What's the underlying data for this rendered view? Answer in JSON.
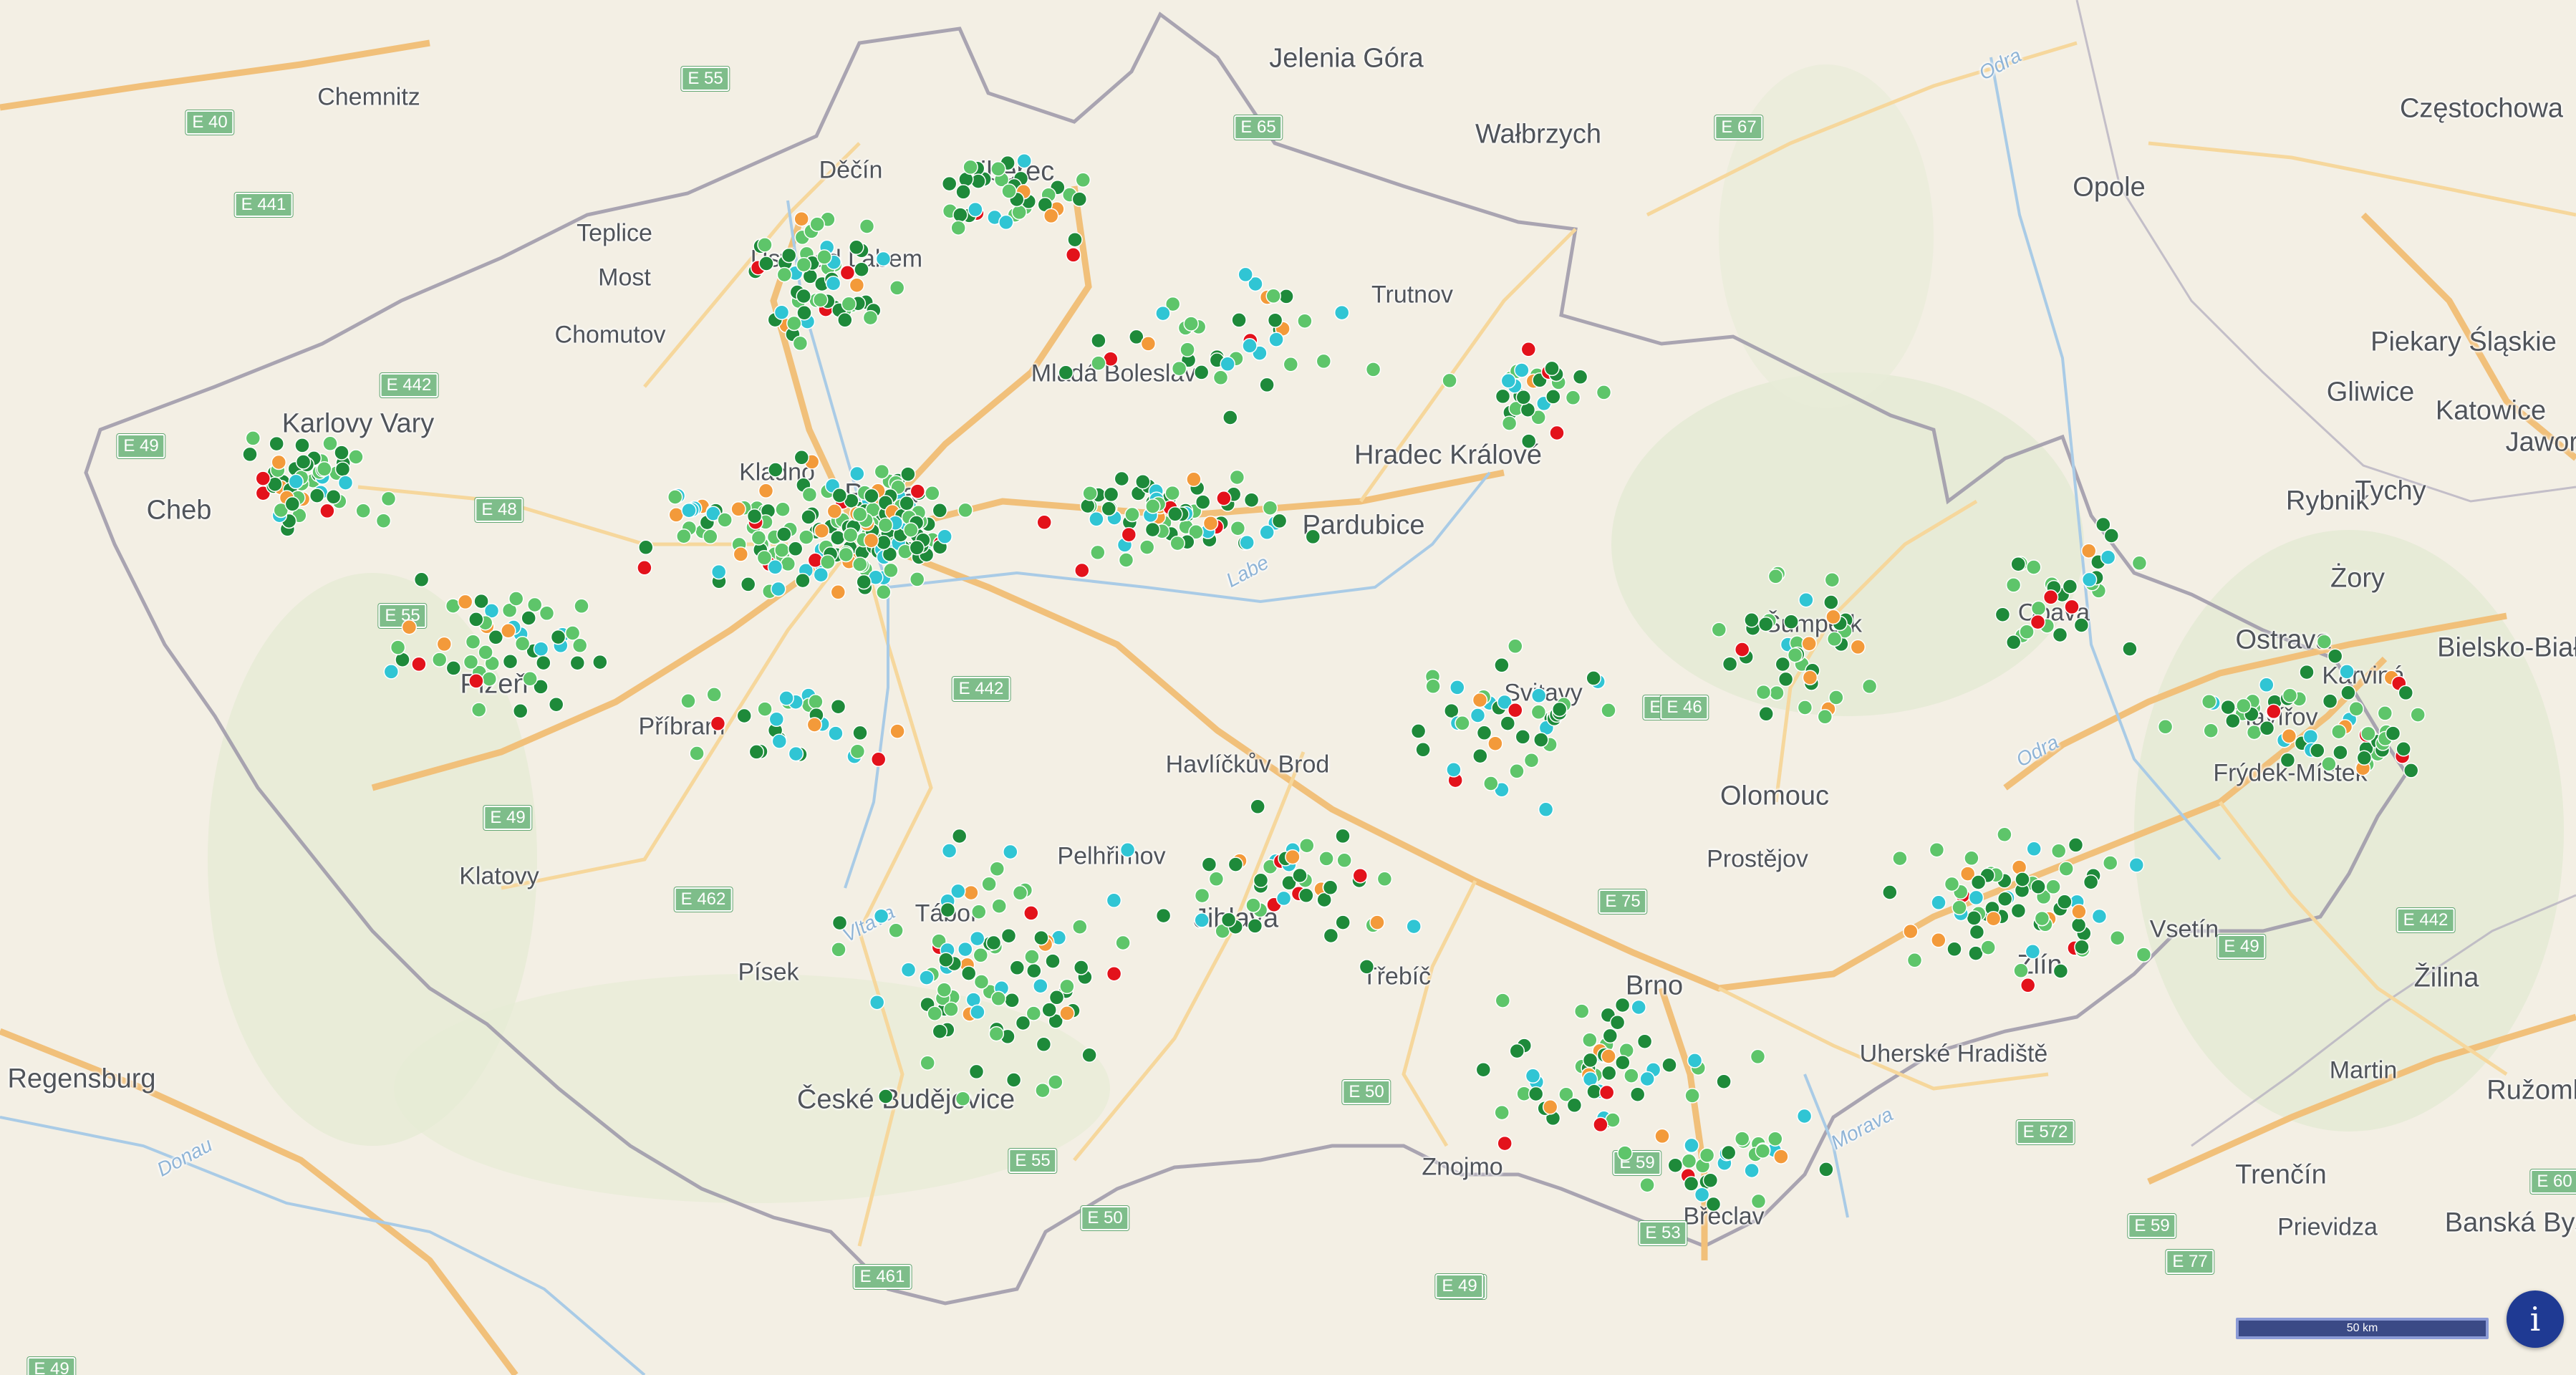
{
  "map": {
    "cities": [
      "Chemnitz",
      "Jelenia Góra",
      "Wałbrzych",
      "Częstochowa",
      "Opole",
      "Liberec",
      "Teplice",
      "Ústí nad Labem",
      "Most",
      "Chomutov",
      "Děčín",
      "Trutnov",
      "Mladá Boleslav",
      "Hradec Králové",
      "Pardubice",
      "Karlovy Vary",
      "Kladno",
      "Praha",
      "Piekary Śląskie",
      "Gliwice",
      "Katowice",
      "Jaworzno",
      "Rybnik",
      "Tychy",
      "Żory",
      "Šumperk",
      "Opava",
      "Ostrava",
      "Bielsko-Biała",
      "Karviná",
      "Havířov",
      "Frýdek-Místek",
      "Plzeň",
      "Příbram",
      "Havlíčkův Brod",
      "Svitavy",
      "Olomouc",
      "Klatovy",
      "Pelhřimov",
      "Prostějov",
      "Tábor",
      "Jihlava",
      "Vsetín",
      "Zlín",
      "Písek",
      "Žilina",
      "Brno",
      "Třebíč",
      "Regensburg",
      "Martin",
      "Ružomberok",
      "České Budějovice",
      "Uherské Hradiště",
      "Znojmo",
      "Trenčín",
      "Prievidza",
      "Banská Bystrica",
      "Břeclav",
      "Cheb"
    ],
    "rivers": [
      "Odra",
      "Labe",
      "Vltava",
      "Morava",
      "Donau",
      "Odra"
    ],
    "roads": [
      "E 55",
      "E 65",
      "E 67",
      "E 40",
      "E 441",
      "E 442",
      "E 49",
      "E 48",
      "E 50",
      "E 55",
      "E 49",
      "E 462",
      "E 442",
      "E 46",
      "E 75",
      "E 442",
      "E 49",
      "E 55",
      "E 461",
      "E 59",
      "E 50",
      "E 75",
      "E 572",
      "E 77",
      "E 59",
      "E 60",
      "E 49",
      "E 53",
      "E 50",
      "E 49"
    ]
  },
  "legend_colors": {
    "dark_green": "#1e8a3a",
    "light_green": "#5ec56a",
    "cyan": "#30c5d4",
    "orange": "#f39a3a",
    "red": "#e3121b"
  },
  "scale_bar": {
    "label": "50 km"
  },
  "info_button": {
    "label": "i"
  }
}
